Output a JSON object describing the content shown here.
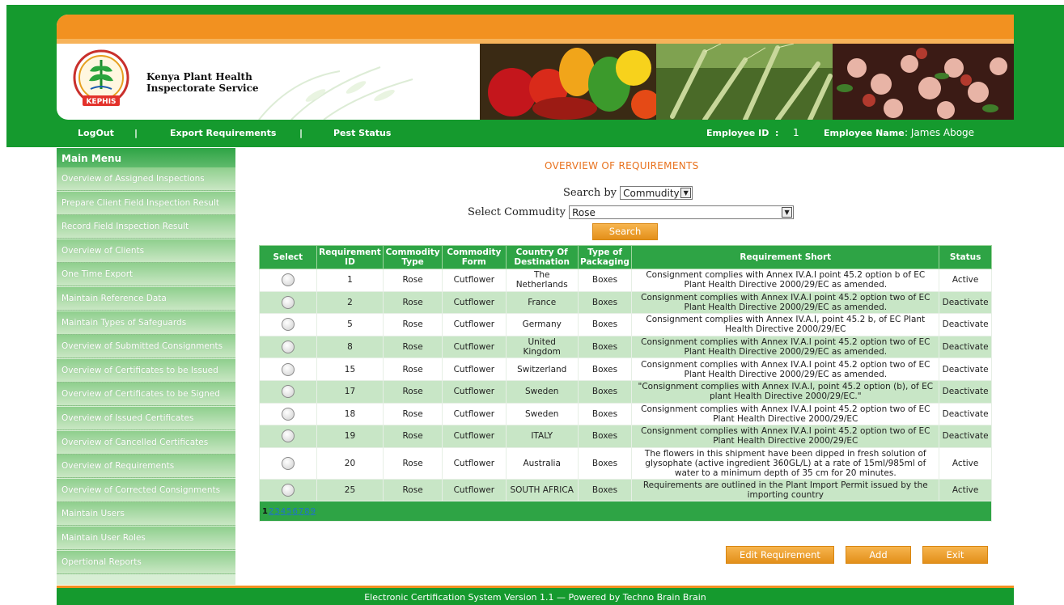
{
  "header": {
    "org_name": "Kenya Plant Health Inspectorate Service",
    "logo_text": "KEPHIS"
  },
  "nav": {
    "logout": "LogOut",
    "sep1": "|",
    "export_requirements": "Export Requirements",
    "sep2": "|",
    "pest_status": "Pest Status",
    "employee_id_label": "Employee ID",
    "employee_id_colon": ":",
    "employee_id_value": "1",
    "employee_name_label": "Employee Name",
    "employee_name_value": ": James Aboge"
  },
  "sidebar": {
    "title": "Main Menu",
    "items": [
      "Overview of Assigned Inspections",
      "Prepare Client Field Inspection Result",
      "Record Field Inspection Result",
      "Overview of Clients",
      "One Time Export",
      "Maintain Reference Data",
      "Maintain Types of Safeguards",
      "Overview of Submitted Consignments",
      "Overview of Certificates to be Issued",
      "Overview of Certificates to be Signed",
      "Overview of Issued Certificates",
      "Overview of Cancelled Certificates",
      "Overview of Requirements",
      "Overview of Corrected Consignments",
      "Maintain Users",
      "Maintain User Roles",
      "Opertional Reports"
    ]
  },
  "main": {
    "title": "OVERVIEW OF REQUIREMENTS",
    "search_by_label": "Search by",
    "search_by_value": "Commudity",
    "select_commodity_label": "Select Commudity",
    "select_commodity_value": "Rose",
    "search_button": "Search",
    "columns": [
      "Select",
      "Requirement ID",
      "Commodity Type",
      "Commodity Form",
      "Country Of Destination",
      "Type of Packaging",
      "Requirement Short",
      "Status"
    ],
    "rows": [
      {
        "id": "1",
        "type": "Rose",
        "form": "Cutflower",
        "country": "The Netherlands",
        "packaging": "Boxes",
        "short": "Consignment complies with Annex IV.A.I point 45.2 option b of EC Plant Health Directive 2000/29/EC as amended.",
        "status": "Active"
      },
      {
        "id": "2",
        "type": "Rose",
        "form": "Cutflower",
        "country": "France",
        "packaging": "Boxes",
        "short": "Consignment complies with Annex IV.A.I point 45.2 option two of EC Plant Health Directive 2000/29/EC as amended.",
        "status": "Deactivate"
      },
      {
        "id": "5",
        "type": "Rose",
        "form": "Cutflower",
        "country": "Germany",
        "packaging": "Boxes",
        "short": "Consignment complies with Annex IV.A.I, point 45.2 b, of EC Plant Health Directive 2000/29/EC",
        "status": "Deactivate"
      },
      {
        "id": "8",
        "type": "Rose",
        "form": "Cutflower",
        "country": "United Kingdom",
        "packaging": "Boxes",
        "short": "Consignment complies with Annex IV.A.I point 45.2 option two of EC Plant Health Directive 2000/29/EC as amended.",
        "status": "Deactivate"
      },
      {
        "id": "15",
        "type": "Rose",
        "form": "Cutflower",
        "country": "Switzerland",
        "packaging": "Boxes",
        "short": "Consignment complies with Annex IV.A.I point 45.2 option two of EC Plant Health Directive 2000/29/EC as amended.",
        "status": "Deactivate"
      },
      {
        "id": "17",
        "type": "Rose",
        "form": "Cutflower",
        "country": "Sweden",
        "packaging": "Boxes",
        "short": "\"Consignment complies with Annex IV.A.I, point 45.2 option (b), of EC plant Health Directive 2000/29/EC.\"",
        "status": "Deactivate"
      },
      {
        "id": "18",
        "type": "Rose",
        "form": "Cutflower",
        "country": "Sweden",
        "packaging": "Boxes",
        "short": "Consignment complies with Annex IV.A.I point 45.2 option two of EC Plant Health Directive 2000/29/EC",
        "status": "Deactivate"
      },
      {
        "id": "19",
        "type": "Rose",
        "form": "Cutflower",
        "country": "ITALY",
        "packaging": "Boxes",
        "short": "Consignment complies with Annex IV.A.I point 45.2 option two of EC Plant Health Directive 2000/29/EC",
        "status": "Deactivate"
      },
      {
        "id": "20",
        "type": "Rose",
        "form": "Cutflower",
        "country": "Australia",
        "packaging": "Boxes",
        "short": "The flowers in this shipment have been dipped in fresh solution of glysophate (active ingredient 360GL/L) at a rate of 15ml/985ml of water to a minimum depth of 35 cm for 20 minutes.",
        "status": "Active"
      },
      {
        "id": "25",
        "type": "Rose",
        "form": "Cutflower",
        "country": "SOUTH AFRICA",
        "packaging": "Boxes",
        "short": "Requirements are outlined in the Plant Import Permit issued by the importing country",
        "status": "Active"
      }
    ],
    "pager": {
      "current": "1",
      "pages": [
        "2",
        "3",
        "4",
        "5",
        "6",
        "7",
        "8",
        "9"
      ]
    },
    "buttons": {
      "edit": "Edit Requirement",
      "add": "Add",
      "exit": "Exit"
    }
  },
  "footer": {
    "text": "Electronic Certification System Version 1.1 — Powered by Techno Brain Brain"
  },
  "colors": {
    "brand_green": "#159a2e",
    "accent_orange": "#f29120",
    "table_header": "#2ea445",
    "row_alt": "#c8e6c6"
  }
}
